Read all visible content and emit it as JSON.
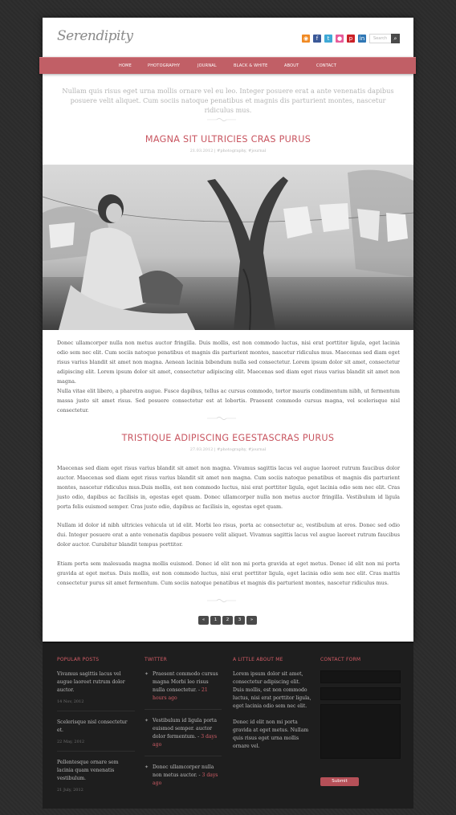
{
  "header": {
    "logo": "Serendipity",
    "social": [
      "rss",
      "facebook",
      "twitter",
      "flickr",
      "pinterest",
      "linkedin"
    ],
    "search_placeholder": "Search"
  },
  "nav": [
    "HOME",
    "PHOTOGRAPHY",
    "JOURNAL",
    "BLACK & WHITE",
    "ABOUT",
    "CONTACT"
  ],
  "intro": "Nullam quis risus eget urna mollis ornare vel eu leo. Integer posuere erat a ante venenatis dapibus posuere velit aliquet. Cum sociis natoque penatibus et magnis dis parturient montes, nascetur ridiculus mus.",
  "posts": [
    {
      "title": "MAGNA SIT ULTRICIES CRAS PURUS",
      "meta": "21.03.2012  |  #photography, #journal",
      "paragraphs": [
        "Donec ullamcorper nulla non metus auctor fringilla. Duis mollis, est non commodo luctus, nisi erat porttitor ligula, eget lacinia odio sem nec elit. Cum sociis natoque penatibus et magnis dis parturient montes, nascetur ridiculus mus. Maecenas sed diam eget risus varius blandit sit amet non magna. Aenean lacinia bibendum nulla sed consectetur. Lorem ipsum dolor sit amet, consectetur adipiscing elit. Lorem ipsum dolor sit amet, consectetur adipiscing elit. Maecenas sed diam eget risus varius blandit sit amet non magna.",
        "Nulla vitae elit libero, a pharetra augue. Fusce dapibus, tellus ac cursus commodo, tortor mauris condimentum nibh, ut fermentum massa justo sit amet risus. Sed posuere consectetur est at lobortis. Praesent commodo cursus magna, vel scelerisque nisl consectetur."
      ]
    },
    {
      "title": "TRISTIQUE ADIPISCING EGESTASCRAS PURUS",
      "meta": "27.03.2012  |  #photography, #journal",
      "paragraphs": [
        "Maecenas sed diam eget risus varius blandit sit amet non magna. Vivamus sagittis lacus vel augue laoreet rutrum faucibus dolor auctor. Maecenas sed diam eget risus varius blandit sit amet non magna. Cum sociis natoque penatibus et magnis dis parturient montes, nascetur ridiculus mus.Duis mollis, est non commodo luctus, nisi erat porttitor ligula, eget lacinia odio sem nec elit. Cras justo odio, dapibus ac facilisis in, egestas eget quam. Donec ullamcorper nulla non metus auctor fringilla. Vestibulum id ligula porta felis euismod semper. Cras justo odio, dapibus ac facilisis in, egestas eget quam.",
        "Nullam id dolor id nibh ultricies vehicula ut id elit. Morbi leo risus, porta ac consectetur ac, vestibulum at eros. Donec sed odio dui. Integer posuere erat a ante venenatis dapibus posuere velit aliquet. Vivamus sagittis lacus vel augue laoreet rutrum faucibus dolor auctor. Curabitur blandit tempus porttitor.",
        "Etiam porta sem malesuada magna mollis euismod. Donec id elit non mi porta gravida at eget metus. Donec id elit non mi porta gravida at eget metus. Duis mollis, est non commodo luctus, nisi erat porttitor ligula, eget lacinia odio sem nec elit. Cras mattis consectetur purus sit amet fermentum. Cum sociis natoque penatibus et magnis dis parturient montes, nascetur ridiculus mus."
      ]
    }
  ],
  "pagination": [
    "«",
    "1",
    "2",
    "3",
    "»"
  ],
  "footer": {
    "popular": {
      "heading": "POPULAR POSTS",
      "items": [
        {
          "text": "Vivamus sagittis lacus vel augue laoreet rutrum dolor auctor.",
          "date": "14 Nov, 2012"
        },
        {
          "text": "Scelerisque nisl consectetur et.",
          "date": "22 May, 2012"
        },
        {
          "text": "Pellentesque ornare sem lacinia quam venenatis vestibulum.",
          "date": "21 July, 2012"
        }
      ]
    },
    "twitter": {
      "heading": "TWITTER",
      "items": [
        {
          "text": "Praesent commodo cursus magna Morbi leo risus nulla consectetur.",
          "ago": "21 hours ago"
        },
        {
          "text": "Vestibulum id ligula porta euismod semper. auctor dolor fermentum.",
          "ago": "3 days ago"
        },
        {
          "text": "Donec ullamcorper nulla non metus auctor.",
          "ago": "3 days ago"
        }
      ]
    },
    "about": {
      "heading": "A LITTLE ABOUT ME",
      "p1": "Lorem ipsum dolor sit amet, consectetur adipiscing elit. Duis mollis, est non commodo luctus, nisi erat porttitor ligula, eget lacinia odio sem nec elit.",
      "p2": "Donec id elit non mi porta gravida at eget metus. Nullam quis risus eget urna mollis ornare vel."
    },
    "contact": {
      "heading": "CONTACT FORM",
      "submit": "Submit"
    }
  }
}
